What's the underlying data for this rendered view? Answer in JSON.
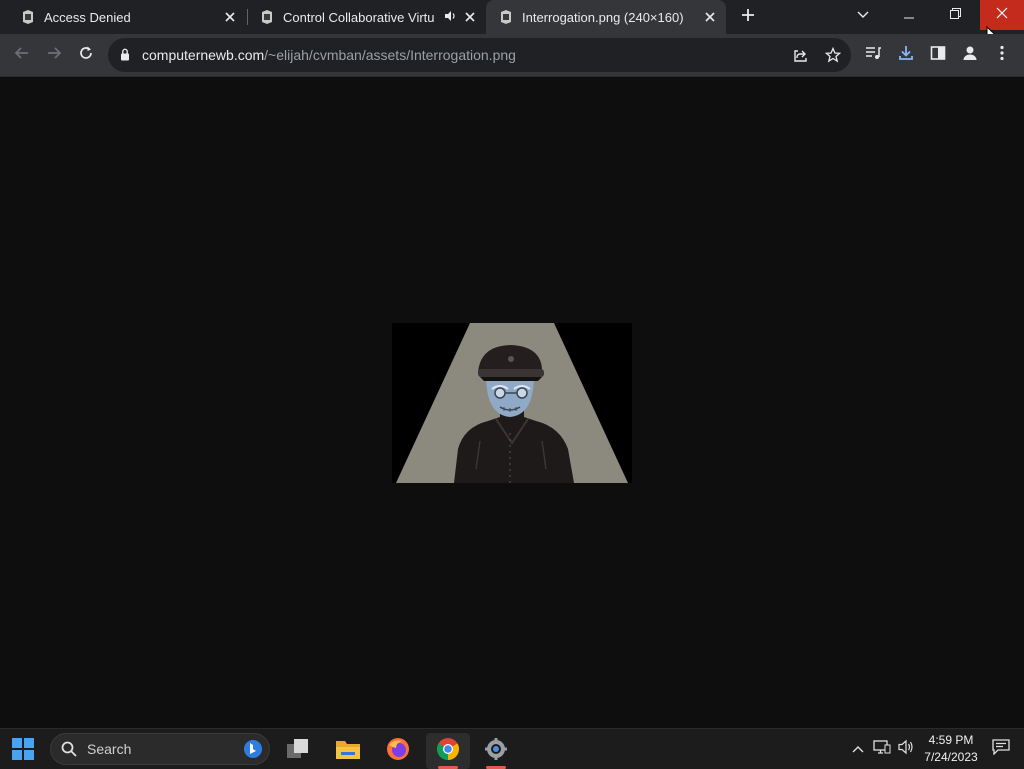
{
  "tabs": [
    {
      "title": "Access Denied"
    },
    {
      "title": "Control Collaborative Virtual"
    },
    {
      "title": "Interrogation.png (240×160)"
    }
  ],
  "address": {
    "host": "computernewb.com",
    "path": "/~elijah/cvmban/assets/Interrogation.png"
  },
  "taskbar": {
    "search_label": "Search",
    "time": "4:59 PM",
    "date": "7/24/2023"
  },
  "colors": {
    "close_hover": "#c42b1c",
    "accent_download": "#8ab4f8",
    "chrome_dark": "#202124",
    "toolbar": "#35363a"
  },
  "icons": [
    "favicon-icon",
    "speaker-icon",
    "close-icon",
    "plus-icon",
    "chevron-down-icon",
    "minimize-icon",
    "restore-icon",
    "back-icon",
    "forward-icon",
    "reload-icon",
    "lock-icon",
    "share-icon",
    "star-icon",
    "media-icon",
    "download-icon",
    "sidepanel-icon",
    "profile-icon",
    "menu-icon",
    "windows-icon",
    "search-icon",
    "bing-icon",
    "taskview-icon",
    "folder-icon",
    "firefox-icon",
    "chrome-icon",
    "settings-icon",
    "chevron-up-icon",
    "display-icon",
    "volume-icon",
    "notification-icon"
  ]
}
